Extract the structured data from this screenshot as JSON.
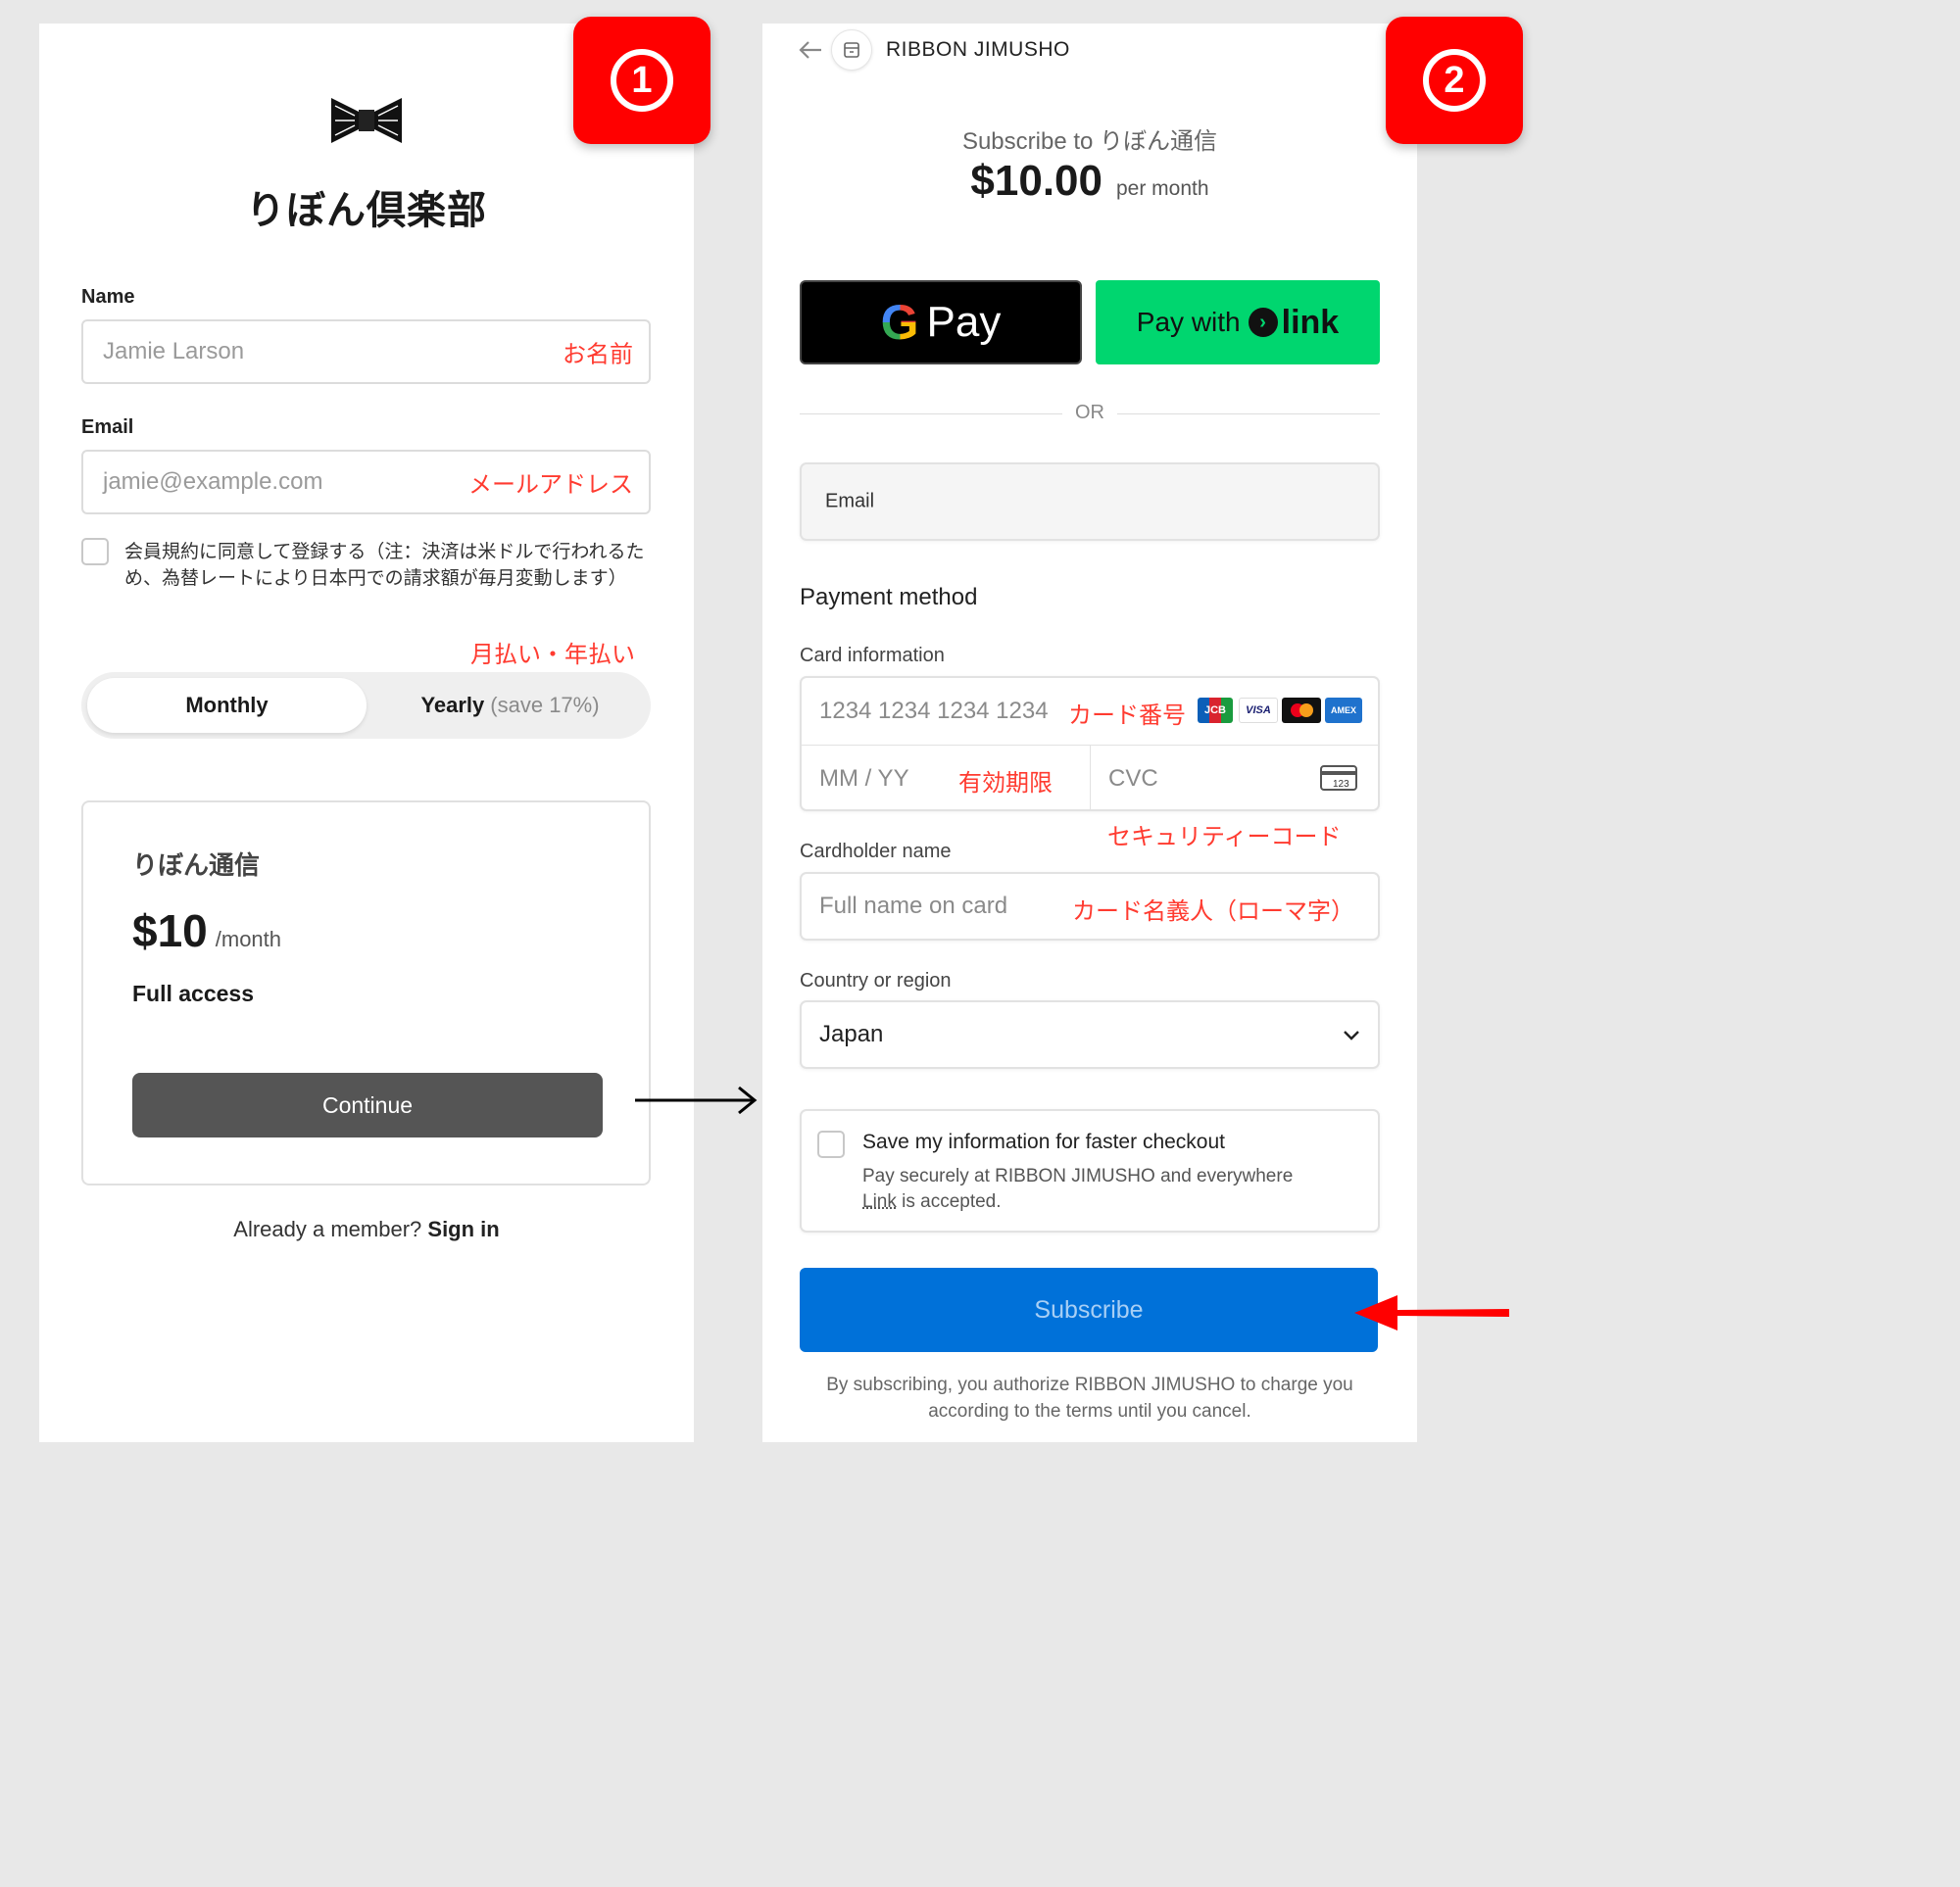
{
  "step1": {
    "badge": "1",
    "club_title": "りぼん倶楽部",
    "name_label": "Name",
    "name_placeholder": "Jamie Larson",
    "name_note": "お名前",
    "email_label": "Email",
    "email_placeholder": "jamie@example.com",
    "email_note": "メールアドレス",
    "terms_text": "会員規約に同意して登録する（注：決済は米ドルで行われるため、為替レートにより日本円での請求額が毎月変動します）",
    "billing_note": "月払い・年払い",
    "toggle_monthly": "Monthly",
    "toggle_yearly": "Yearly",
    "toggle_yearly_save": "(save 17%)",
    "plan_name": "りぼん通信",
    "plan_price": "$10",
    "plan_period": "/month",
    "plan_feature": "Full access",
    "continue_label": "Continue",
    "signin_prefix": "Already a member?",
    "signin_link": "Sign in"
  },
  "step2": {
    "badge": "2",
    "merchant": "RIBBON JIMUSHO",
    "subscribe_to": "Subscribe to りぼん通信",
    "price": "$10.00",
    "price_period": "per month",
    "gpay_label": "Pay",
    "link_prefix": "Pay with",
    "link_label": "link",
    "or_label": "OR",
    "email_placeholder": "Email",
    "payment_method_heading": "Payment method",
    "card_info_label": "Card information",
    "card_number_placeholder": "1234 1234 1234 1234",
    "card_number_note": "カード番号",
    "card_brands": [
      "JCB",
      "VISA",
      "Mastercard",
      "AMEX"
    ],
    "expiry_placeholder": "MM / YY",
    "expiry_note": "有効期限",
    "cvc_placeholder": "CVC",
    "cvc_note": "セキュリティーコード",
    "cardholder_label": "Cardholder name",
    "cardholder_placeholder": "Full name on card",
    "cardholder_note": "カード名義人（ローマ字）",
    "country_label": "Country or region",
    "country_value": "Japan",
    "save_info_title": "Save my information for faster checkout",
    "save_info_line1": "Pay securely at RIBBON JIMUSHO and everywhere",
    "save_info_link": "Link",
    "save_info_line2": "is accepted.",
    "subscribe_label": "Subscribe",
    "legal_line1": "By subscribing, you authorize RIBBON JIMUSHO to charge you",
    "legal_line2": "according to the terms until you cancel."
  },
  "colors": {
    "badge_red": "#ff0000",
    "note_red": "#ff3b30",
    "subscribe_blue": "#0071d9",
    "link_green": "#00d66f",
    "continue_gray": "#555555"
  }
}
